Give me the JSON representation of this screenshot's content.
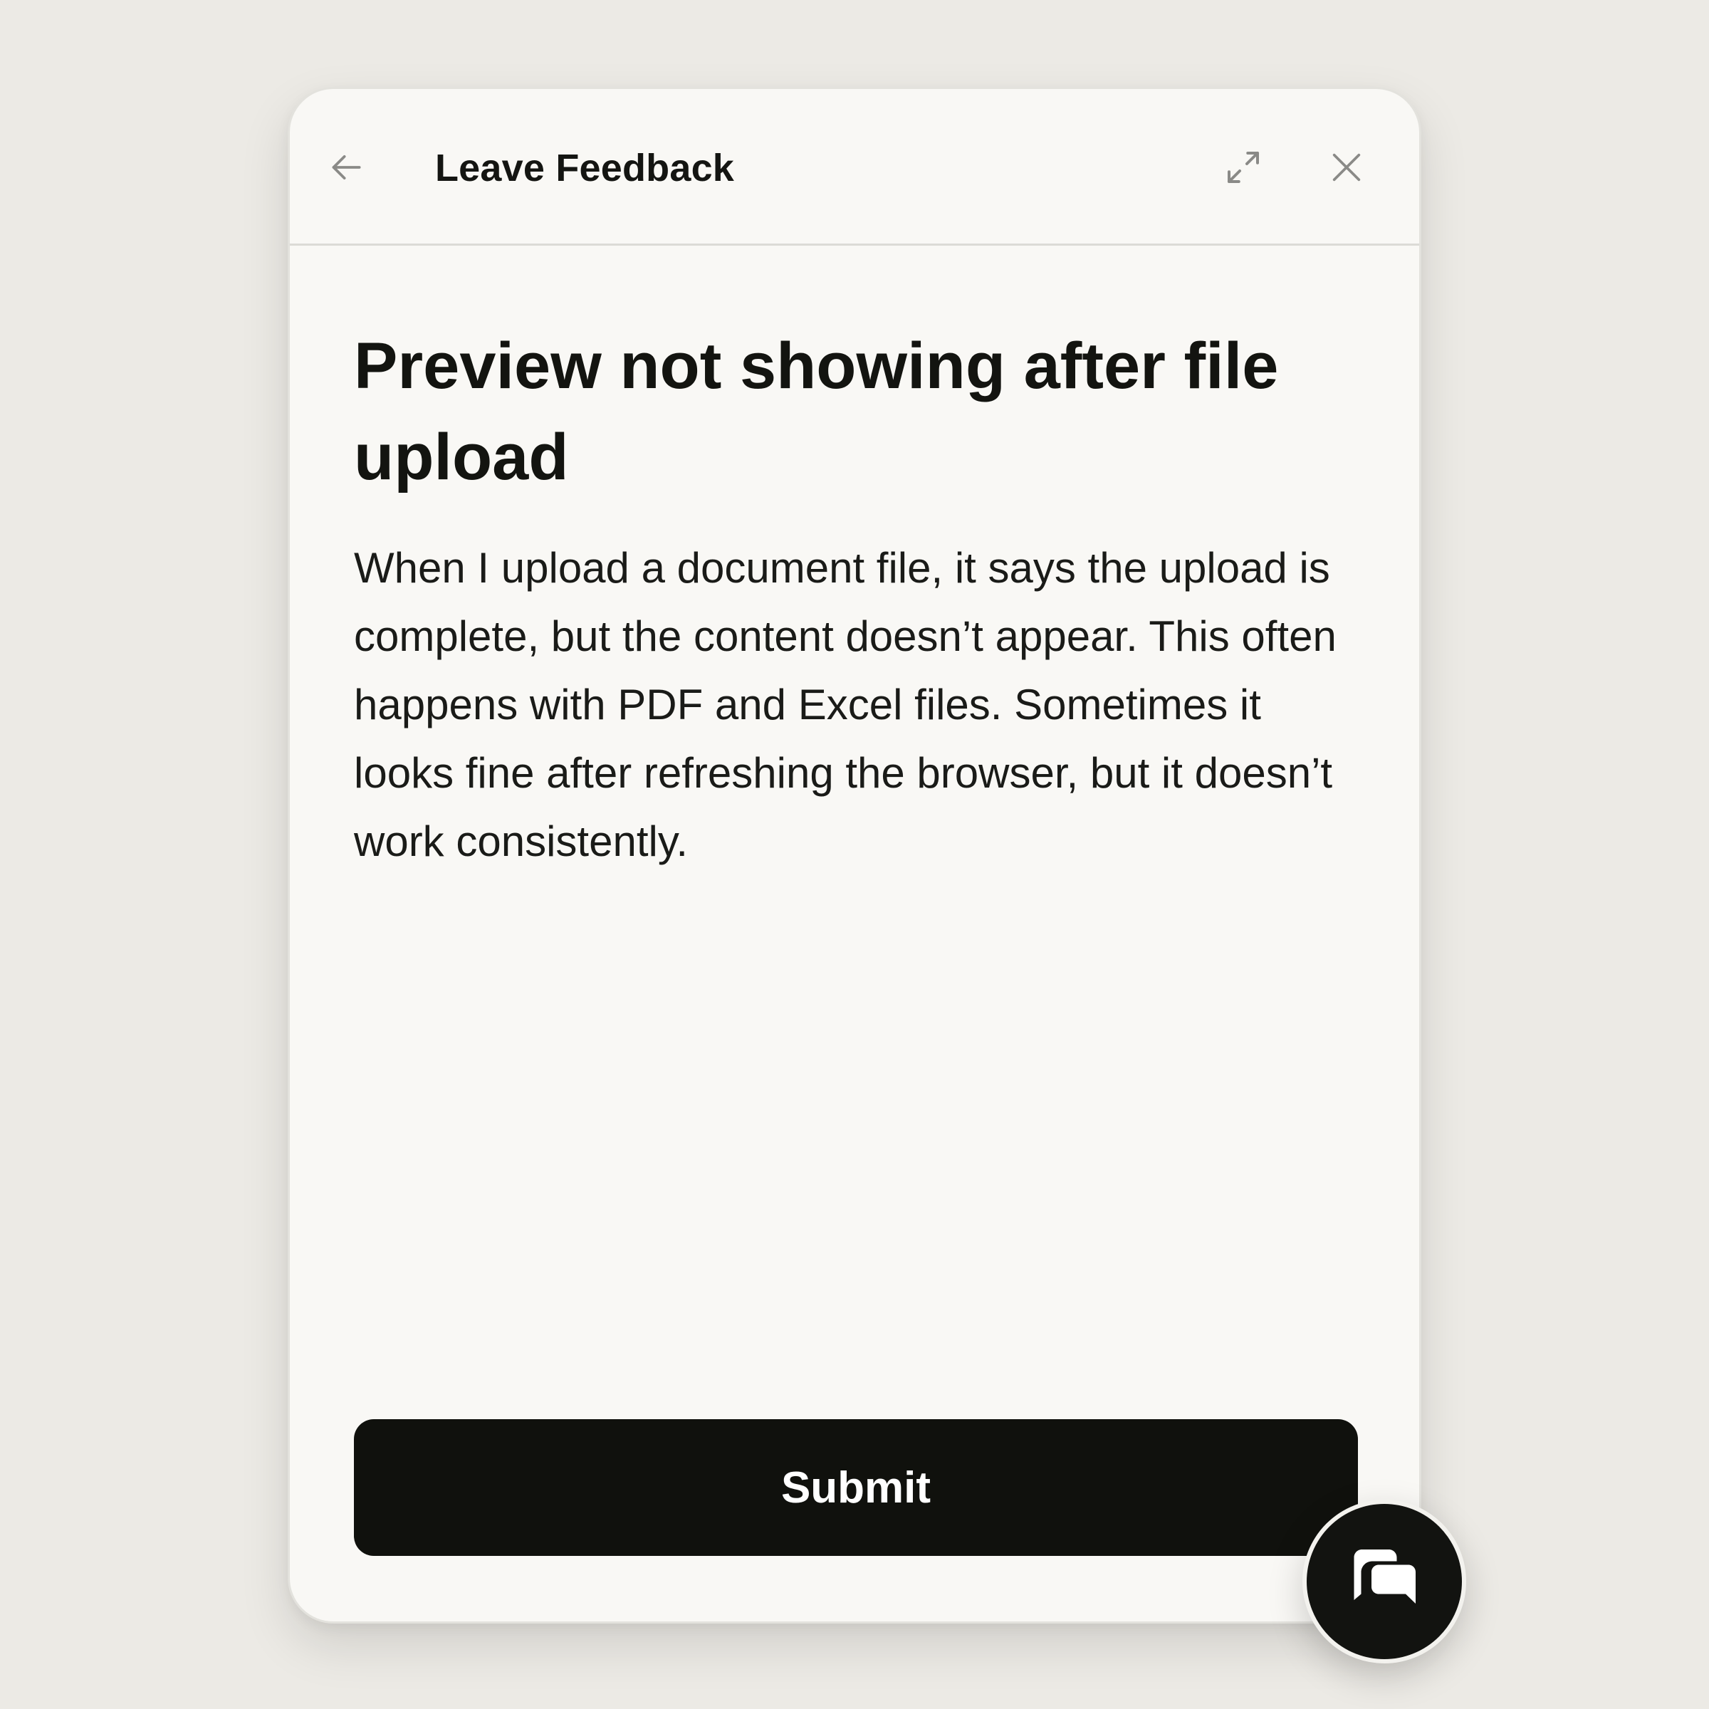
{
  "header": {
    "title": "Leave Feedback",
    "back_icon": "arrow-left-icon",
    "expand_icon": "expand-icon",
    "close_icon": "close-icon"
  },
  "feedback": {
    "title": "Preview not showing after file upload",
    "body": "When I upload a document file, it says the upload is complete, but the content doesn’t appear. This often happens with PDF and Excel files. Sometimes it looks fine after refreshing the browser, but it doesn’t work consistently."
  },
  "actions": {
    "submit_label": "Submit"
  },
  "fab": {
    "icon": "chat-bubbles-icon"
  },
  "colors": {
    "background": "#ecEAe5",
    "panel": "#f9f8f5",
    "primary_button": "#10110d",
    "icon_gray": "#8a8a87"
  }
}
